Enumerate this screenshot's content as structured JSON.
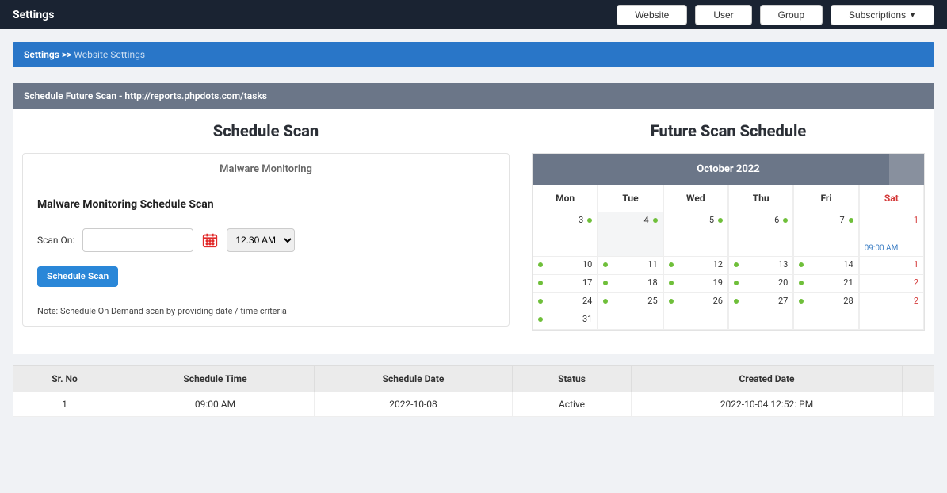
{
  "topbar": {
    "title": "Settings",
    "nav": {
      "website": "Website",
      "user": "User",
      "group": "Group",
      "subscriptions": "Subscriptions"
    }
  },
  "breadcrumb": {
    "root": "Settings",
    "sep": ">>",
    "current": "Website Settings"
  },
  "panel": {
    "title": "Schedule Future Scan - http://reports.phpdots.com/tasks"
  },
  "schedule": {
    "heading": "Schedule Scan",
    "tab": "Malware Monitoring",
    "subtitle": "Malware Monitoring Schedule Scan",
    "scan_on_label": "Scan On:",
    "date_value": "",
    "time_selected": "12.30 AM",
    "button": "Schedule Scan",
    "note": "Note: Schedule On Demand scan by providing date / time criteria"
  },
  "calendar": {
    "heading": "Future Scan Schedule",
    "month": "October 2022",
    "days": {
      "mon": "Mon",
      "tue": "Tue",
      "wed": "Wed",
      "thu": "Thu",
      "fri": "Fri",
      "sat": "Sat"
    },
    "weeks": [
      [
        {
          "n": "3",
          "dot": "right"
        },
        {
          "n": "4",
          "dot": "right",
          "today": true
        },
        {
          "n": "5",
          "dot": "right"
        },
        {
          "n": "6",
          "dot": "right"
        },
        {
          "n": "7",
          "dot": "right"
        },
        {
          "n": "1",
          "red": true,
          "event": "09:00 AM"
        }
      ],
      [
        {
          "n": "10",
          "dot": "left"
        },
        {
          "n": "11",
          "dot": "left"
        },
        {
          "n": "12",
          "dot": "left"
        },
        {
          "n": "13",
          "dot": "left"
        },
        {
          "n": "14",
          "dot": "left"
        },
        {
          "n": "1",
          "red": true
        }
      ],
      [
        {
          "n": "17",
          "dot": "left"
        },
        {
          "n": "18",
          "dot": "left"
        },
        {
          "n": "19",
          "dot": "left"
        },
        {
          "n": "20",
          "dot": "left"
        },
        {
          "n": "21",
          "dot": "left"
        },
        {
          "n": "2",
          "red": true
        }
      ],
      [
        {
          "n": "24",
          "dot": "left"
        },
        {
          "n": "25",
          "dot": "left"
        },
        {
          "n": "26",
          "dot": "left"
        },
        {
          "n": "27",
          "dot": "left"
        },
        {
          "n": "28",
          "dot": "left"
        },
        {
          "n": "2",
          "red": true
        }
      ],
      [
        {
          "n": "31",
          "dot": "left"
        },
        {
          "n": ""
        },
        {
          "n": ""
        },
        {
          "n": ""
        },
        {
          "n": ""
        },
        {
          "n": ""
        }
      ]
    ]
  },
  "table": {
    "headers": {
      "srno": "Sr. No",
      "time": "Schedule Time",
      "date": "Schedule Date",
      "status": "Status",
      "created": "Created Date",
      "actions": ""
    },
    "rows": [
      {
        "srno": "1",
        "time": "09:00 AM",
        "date": "2022-10-08",
        "status": "Active",
        "created": "2022-10-04 12:52: PM"
      }
    ]
  }
}
